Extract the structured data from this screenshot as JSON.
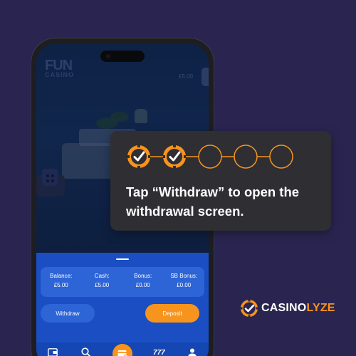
{
  "app": {
    "logo_line1": "FUN",
    "logo_line2": "CASINO",
    "top_balance": "£5.00"
  },
  "balances": [
    {
      "label": "Balance:",
      "value": "£5.00"
    },
    {
      "label": "Cash:",
      "value": "£5.00"
    },
    {
      "label": "Bonus:",
      "value": "£0.00"
    },
    {
      "label": "SB Bonus:",
      "value": "£0.00"
    }
  ],
  "actions": {
    "withdraw_label": "Withdraw",
    "deposit_label": "Deposit"
  },
  "bottom_nav": [
    {
      "icon": "wallet-icon"
    },
    {
      "icon": "search-icon"
    },
    {
      "icon": "cashier-icon"
    },
    {
      "icon": "777-slots-icon",
      "label": "777"
    },
    {
      "icon": "user-icon"
    }
  ],
  "step_card": {
    "total_steps": 5,
    "completed_steps": 2,
    "instruction": "Tap “Withdraw” to open the withdrawal screen."
  },
  "brand": {
    "part1": "CASINO",
    "part2": "LYZE",
    "icon": "chip-check-icon"
  },
  "colors": {
    "background": "#2a2550",
    "accent": "#f7941d",
    "sheet_blue": "#1a4ec2",
    "card": "#2e2e33"
  }
}
